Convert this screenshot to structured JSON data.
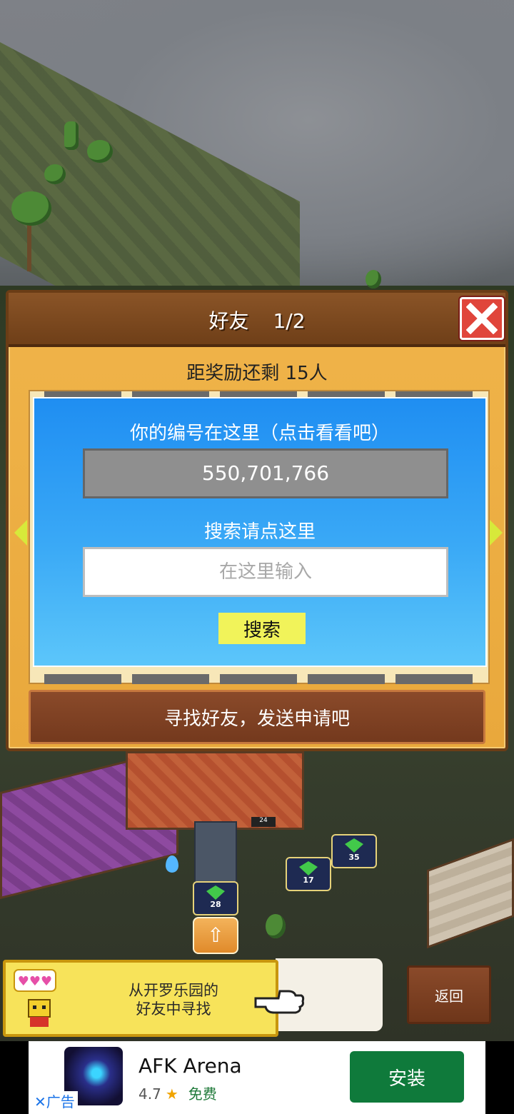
{
  "dialog": {
    "title": "好友",
    "page": "1/2",
    "reward_text": "距奖励还剩 15人",
    "id_prompt": "你的编号在这里（点击看看吧）",
    "player_id": "550,701,766",
    "search_prompt": "搜索请点这里",
    "search_placeholder": "在这里输入",
    "search_button": "搜索",
    "find_friends_button": "寻找好友，发送申请吧"
  },
  "scene": {
    "badges": [
      {
        "value": "28"
      },
      {
        "value": "17"
      },
      {
        "value": "35"
      }
    ],
    "room_sign": "24"
  },
  "notice": {
    "line1": "从开罗乐园的",
    "line2": "好友中寻找",
    "back_button": "返回"
  },
  "ad": {
    "title": "AFK Arena",
    "rating": "4.7",
    "price": "免费",
    "install_button": "安装",
    "ad_tag": "广告"
  },
  "colors": {
    "dialog_bg": "#f0b44a",
    "titlebar": "#7a461c",
    "blue_panel": "#2a9cf4",
    "search_button": "#f1f35a",
    "close_button": "#e0453b",
    "install_button": "#0f7a3b"
  },
  "icons": [
    "close-icon",
    "arrow-left-icon",
    "arrow-right-icon",
    "gem-icon",
    "upgrade-arrow-icon",
    "pointing-hand-icon",
    "star-icon",
    "close-ad-icon"
  ]
}
